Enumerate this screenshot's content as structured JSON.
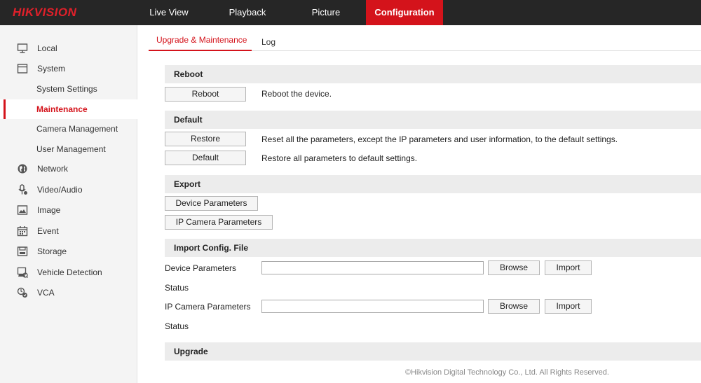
{
  "header": {
    "logo": "HIKVISION",
    "nav": [
      {
        "label": "Live View",
        "active": false
      },
      {
        "label": "Playback",
        "active": false
      },
      {
        "label": "Picture",
        "active": false
      },
      {
        "label": "Configuration",
        "active": true
      }
    ]
  },
  "sidebar": {
    "items": [
      {
        "label": "Local",
        "icon": "monitor-icon"
      },
      {
        "label": "System",
        "icon": "system-window-icon"
      },
      {
        "label": "System Settings",
        "sub": true
      },
      {
        "label": "Maintenance",
        "sub": true,
        "active": true
      },
      {
        "label": "Camera Management",
        "sub": true
      },
      {
        "label": "User Management",
        "sub": true
      },
      {
        "label": "Network",
        "icon": "globe-icon"
      },
      {
        "label": "Video/Audio",
        "icon": "microphone-icon"
      },
      {
        "label": "Image",
        "icon": "image-icon"
      },
      {
        "label": "Event",
        "icon": "calendar-icon"
      },
      {
        "label": "Storage",
        "icon": "storage-icon"
      },
      {
        "label": "Vehicle Detection",
        "icon": "vehicle-detection-icon"
      },
      {
        "label": "VCA",
        "icon": "vca-icon"
      }
    ]
  },
  "tabs": [
    {
      "label": "Upgrade & Maintenance",
      "active": true
    },
    {
      "label": "Log",
      "active": false
    }
  ],
  "reboot": {
    "title": "Reboot",
    "button": "Reboot",
    "desc": "Reboot the device."
  },
  "default": {
    "title": "Default",
    "restore_button": "Restore",
    "restore_desc": "Reset all the parameters, except the IP parameters and user information, to the default settings.",
    "default_button": "Default",
    "default_desc": "Restore all parameters to default settings."
  },
  "export": {
    "title": "Export",
    "device_button": "Device Parameters",
    "ipcam_button": "IP Camera Parameters"
  },
  "import": {
    "title": "Import Config. File",
    "device_label": "Device Parameters",
    "device_value": "",
    "status_label": "Status",
    "ipcam_label": "IP Camera Parameters",
    "ipcam_value": "",
    "browse": "Browse",
    "import": "Import"
  },
  "upgrade": {
    "title": "Upgrade"
  },
  "footer": "©Hikvision Digital Technology Co., Ltd. All Rights Reserved.",
  "colors": {
    "accent": "#d4131b",
    "header_bg": "#262626"
  }
}
